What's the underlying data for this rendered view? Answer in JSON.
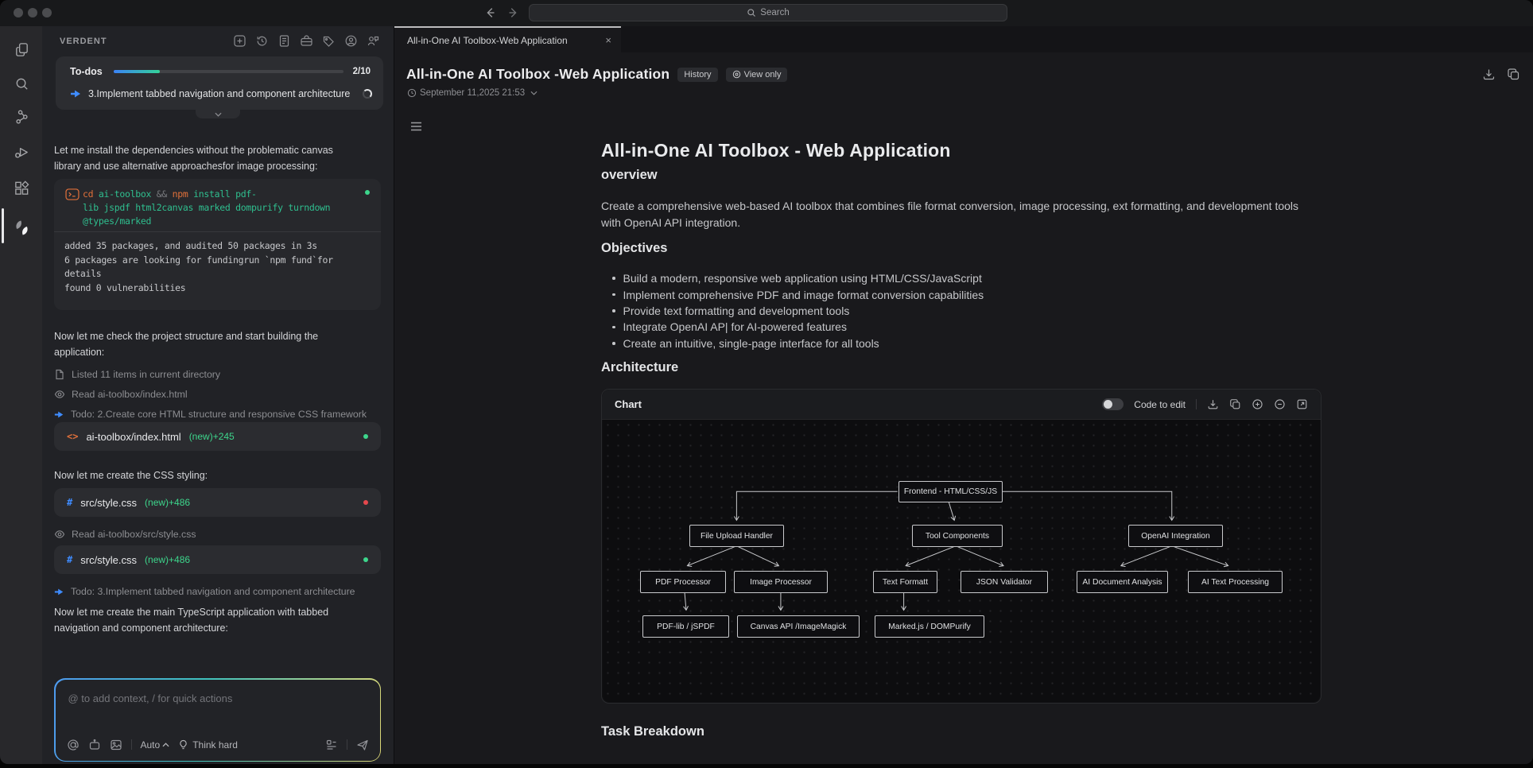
{
  "window": {
    "search": {
      "placeholder": "Search"
    }
  },
  "activity_bar": {
    "icons": [
      "files",
      "search",
      "flow",
      "debug",
      "extensions",
      "verdent-logo"
    ]
  },
  "sidebar": {
    "title": "VERDENT",
    "header_icons": [
      "new-task",
      "history",
      "report",
      "toolbox",
      "tags",
      "account",
      "feedback"
    ],
    "todos": {
      "label": "To-dos",
      "count": "2/10",
      "progress_percent": 20,
      "active_task": "3.Implement tabbed navigation and component architecture"
    },
    "stream": {
      "msg1": "Let me install the dependencies without the problematic canvas library and use alternative approachesfor image processing:",
      "terminal": {
        "line1": [
          {
            "text": "cd ",
            "color": "orange"
          },
          {
            "text": "ai-toolbox ",
            "color": "green"
          },
          {
            "text": "&& ",
            "color": "gray"
          },
          {
            "text": "npm ",
            "color": "orange"
          },
          {
            "text": "install pdf-",
            "color": "green"
          }
        ],
        "line2": "lib jspdf html2canvas marked dompurify turndown",
        "line3": "@types/marked",
        "output": [
          "added 35 packages, and audited 50 packages in 3s",
          "6 packages are looking for fundingrun `npm fund`for details",
          "found 0 vulnerabilities"
        ]
      },
      "msg2": "Now let me check the project structure and start building the application:",
      "tool1": "Listed 11 items in current directory",
      "tool2": "Read ai-toolbox/index.html",
      "todo1": "Todo: 2.Create core HTML structure and responsive CSS framework",
      "file1": {
        "icon": "<>",
        "name": "ai-toolbox/index.html",
        "meta": "(new)+245"
      },
      "msg3": "Now let me create the CSS styling:",
      "file2": {
        "icon": "#",
        "name": "src/style.css",
        "meta": "(new)+486"
      },
      "tool3": "Read ai-toolbox/src/style.css",
      "file3": {
        "icon": "#",
        "name": "src/style.css",
        "meta": "(new)+486"
      },
      "todo2": "Todo: 3.Implement tabbed navigation and component architecture",
      "msg4": "Now let me create the main TypeScript application with tabbed navigation and component architecture:"
    },
    "composer": {
      "placeholder": "@ to add context, / for quick actions",
      "mode": "Auto",
      "think": "Think hard"
    }
  },
  "editor": {
    "tab": {
      "title": "All-in-One AI Toolbox-Web Application"
    },
    "header": {
      "title": "All-in-One AI Toolbox -Web Application",
      "badge_history": "History",
      "badge_view": "View only",
      "date": "September 11,2025 21:53"
    },
    "doc": {
      "h1": "All-in-One AI Toolbox - Web Application",
      "h2_overview": "overview",
      "overview_text": "Create a comprehensive web-based AI toolbox that combines file format conversion, image processing, ext formatting, and development tools with OpenAI API integration.",
      "h2_objectives": "Objectives",
      "objectives": [
        "Build a modern, responsive web application using HTML/CSS/JavaScript",
        "Implement comprehensive PDF and image format conversion capabilities",
        "Provide text formatting and development tools",
        "Integrate OpenAI AP| for AI-powered features",
        "Create an intuitive, single-page interface for all tools"
      ],
      "h2_architecture": "Architecture",
      "chart": {
        "panel_title": "Chart",
        "toggle_label": "Code to edit",
        "nodes": {
          "root": "Frontend - HTML/CSS/JS",
          "l2a": "File Upload Handler",
          "l2b": "Tool Components",
          "l2c": "OpenAI Integration",
          "l3a": "PDF Processor",
          "l3b": "Image Processor",
          "l3c": "Text Formatt",
          "l3d": "JSON Validator",
          "l3e": "AI Document Analysis",
          "l3f": "AI Text Processing",
          "l4a": "PDF-lib / jSPDF",
          "l4b": "Canvas API /ImageMagick",
          "l4c": "Marked.js / DOMPurify"
        }
      },
      "h2_tasks": "Task Breakdown"
    }
  }
}
